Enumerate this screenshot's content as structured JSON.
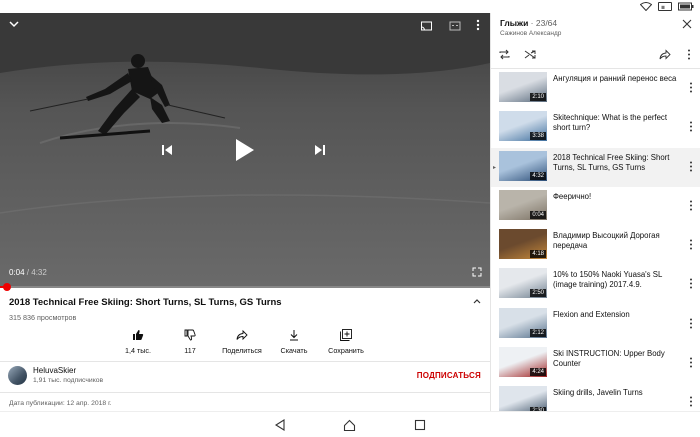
{
  "video": {
    "current_time": "0:04",
    "time_separator": " / ",
    "duration": "4:32",
    "progress_fraction": 0.015
  },
  "details": {
    "title": "2018 Technical Free Skiing: Short Turns, SL Turns, GS Turns",
    "views": "315 836 просмотров",
    "actions": {
      "like": "1,4 тыс.",
      "dislike": "117",
      "share": "Поделиться",
      "download": "Скачать",
      "save": "Сохранить"
    },
    "channel": {
      "name": "HeluvaSkier",
      "subscribers": "1,91 тыс. подписчиков",
      "subscribe_label": "ПОДПИСАТЬСЯ"
    },
    "published": "Дата публикации: 12 апр. 2018 г."
  },
  "playlist": {
    "title": "Глыжи",
    "position": " · 23/64",
    "owner": "Сажинов Александр",
    "items": [
      {
        "title": "Ангуляция и ранний перенос веса",
        "duration": "2:10",
        "active": false
      },
      {
        "title": "Skitechnique: What is the perfect short turn?",
        "duration": "3:38",
        "active": false
      },
      {
        "title": "2018 Technical Free Skiing: Short Turns, SL Turns, GS Turns",
        "duration": "4:32",
        "active": true
      },
      {
        "title": "Феерично!",
        "duration": "0:04",
        "active": false
      },
      {
        "title": "Владимир Высоцкий Дорогая передача",
        "duration": "4:18",
        "active": false
      },
      {
        "title": "10% to 150% Naoki Yuasa's SL (image training) 2017.4.9.",
        "duration": "2:50",
        "active": false
      },
      {
        "title": "Flexion and Extension",
        "duration": "2:12",
        "active": false
      },
      {
        "title": "Ski INSTRUCTION: Upper Body Counter",
        "duration": "4:24",
        "active": false
      },
      {
        "title": "Skiing drills, Javelin Turns",
        "duration": "2:30",
        "active": false
      }
    ]
  },
  "colors": {
    "accent_red": "#cc0000",
    "progress_red": "#e00000"
  }
}
